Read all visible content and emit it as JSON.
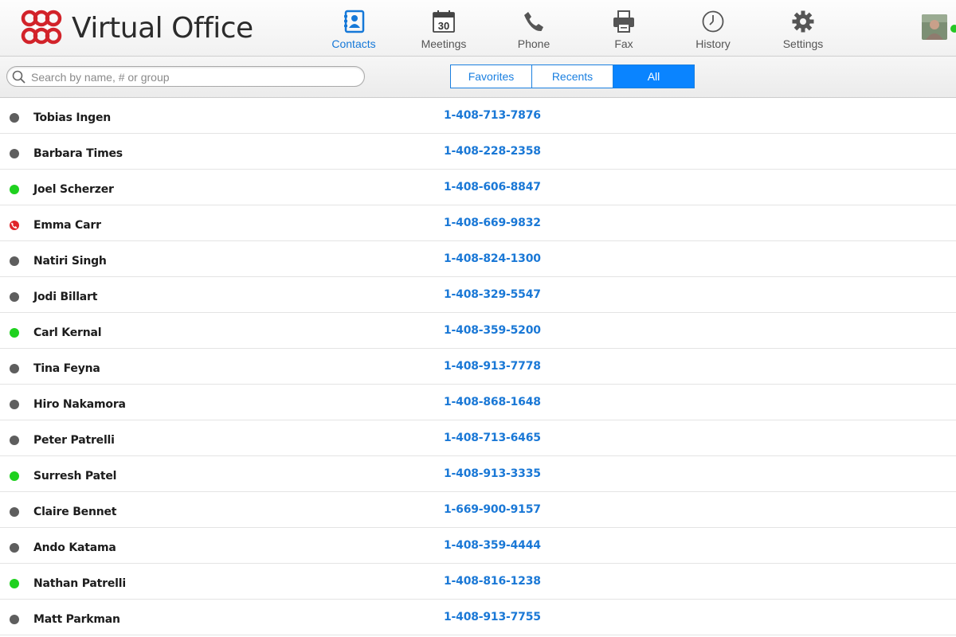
{
  "app": {
    "title": "Virtual Office",
    "logo_icon": "virtual-office-logo"
  },
  "nav": [
    {
      "label": "Contacts",
      "icon": "contacts-icon",
      "active": true
    },
    {
      "label": "Meetings",
      "icon": "calendar-icon",
      "calendar_day": "30",
      "active": false
    },
    {
      "label": "Phone",
      "icon": "phone-icon",
      "active": false
    },
    {
      "label": "Fax",
      "icon": "fax-icon",
      "active": false
    },
    {
      "label": "History",
      "icon": "clock-icon",
      "active": false
    },
    {
      "label": "Settings",
      "icon": "gear-icon",
      "active": false
    }
  ],
  "user": {
    "presence": "online"
  },
  "search": {
    "placeholder": "Search by name, # or group",
    "value": ""
  },
  "filters": [
    {
      "label": "Favorites",
      "active": false
    },
    {
      "label": "Recents",
      "active": false
    },
    {
      "label": "All",
      "active": true
    }
  ],
  "colors": {
    "accent": "#0a84ff",
    "online": "#1fd11f",
    "offline": "#5e5e5e",
    "busy": "#e0242a",
    "brand_red": "#d2232a"
  },
  "contacts": [
    {
      "name": "Tobias Ingen",
      "phone": "1-408-713-7876",
      "status": "offline"
    },
    {
      "name": "Barbara Times",
      "phone": "1-408-228-2358",
      "status": "offline"
    },
    {
      "name": "Joel Scherzer",
      "phone": "1-408-606-8847",
      "status": "online"
    },
    {
      "name": "Emma Carr",
      "phone": "1-408-669-9832",
      "status": "busy"
    },
    {
      "name": "Natiri Singh",
      "phone": "1-408-824-1300",
      "status": "offline"
    },
    {
      "name": "Jodi Billart",
      "phone": "1-408-329-5547",
      "status": "offline"
    },
    {
      "name": "Carl Kernal",
      "phone": "1-408-359-5200",
      "status": "online"
    },
    {
      "name": "Tina Feyna",
      "phone": "1-408-913-7778",
      "status": "offline"
    },
    {
      "name": "Hiro Nakamora",
      "phone": "1-408-868-1648",
      "status": "offline"
    },
    {
      "name": "Peter Patrelli",
      "phone": "1-408-713-6465",
      "status": "offline"
    },
    {
      "name": "Surresh Patel",
      "phone": "1-408-913-3335",
      "status": "online"
    },
    {
      "name": "Claire Bennet",
      "phone": "1-669-900-9157",
      "status": "offline"
    },
    {
      "name": "Ando Katama",
      "phone": "1-408-359-4444",
      "status": "offline"
    },
    {
      "name": "Nathan Patrelli",
      "phone": "1-408-816-1238",
      "status": "online"
    },
    {
      "name": "Matt Parkman",
      "phone": "1-408-913-7755",
      "status": "offline"
    }
  ]
}
